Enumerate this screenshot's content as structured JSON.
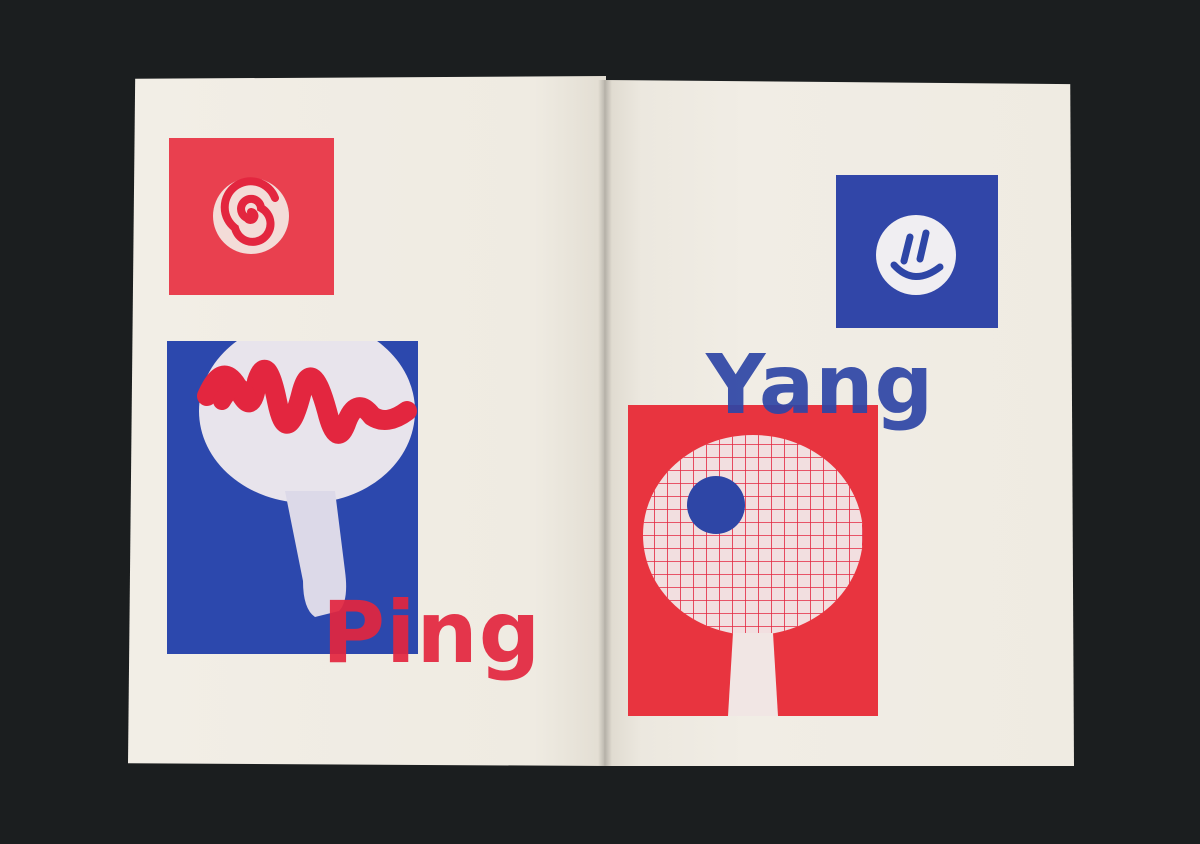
{
  "words": {
    "left": "Ping",
    "right": "Yang"
  },
  "colors": {
    "background": "#1b1e1f",
    "paper": "#f1ede4",
    "red": "#e3263f",
    "blue": "#2e46a6"
  },
  "icons": {
    "left_top": "spiral-ball-icon",
    "left_main": "paddle-with-scribble-icon",
    "right_top": "smiley-ball-icon",
    "right_main": "paddle-with-grid-icon"
  }
}
